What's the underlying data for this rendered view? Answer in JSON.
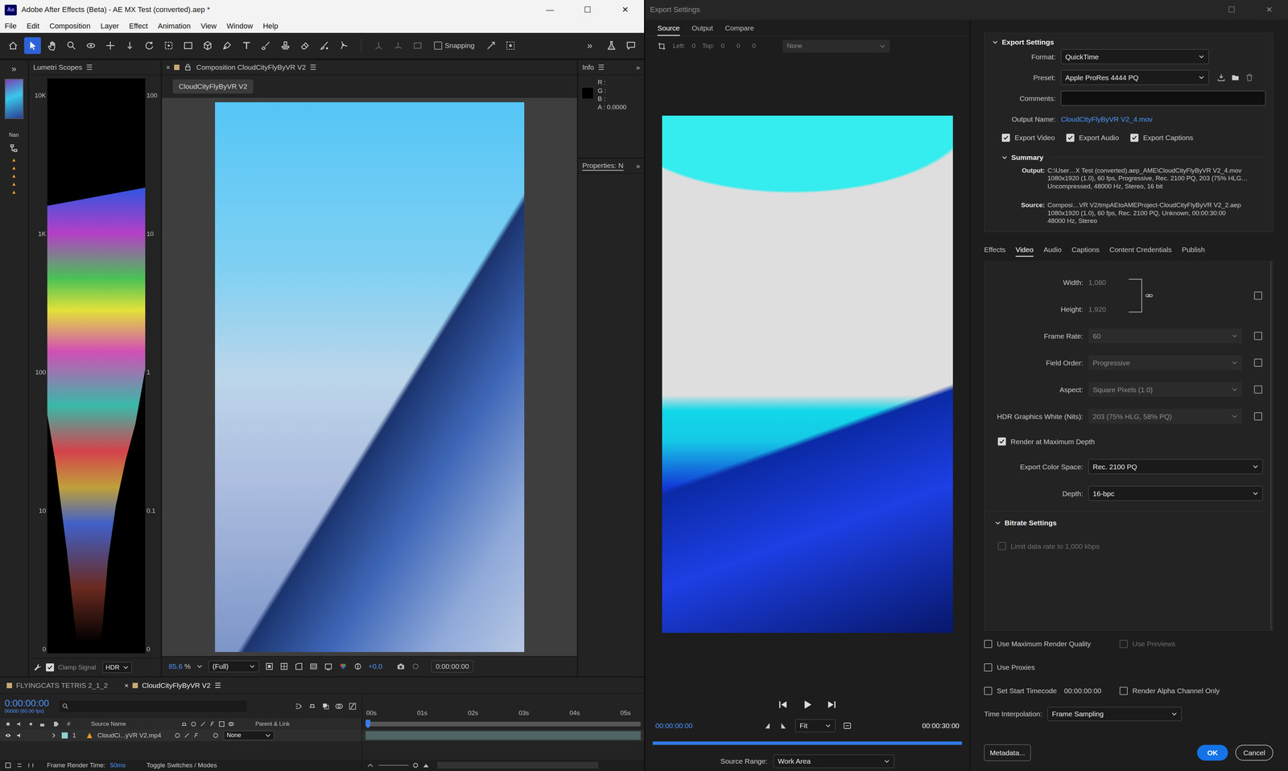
{
  "ae": {
    "title": "Adobe After Effects (Beta) - AE MX Test (converted).aep *",
    "app_badge": "Ae",
    "window_controls": [
      "—",
      "☐",
      "✕"
    ],
    "menu": [
      "File",
      "Edit",
      "Composition",
      "Layer",
      "Effect",
      "Animation",
      "View",
      "Window",
      "Help"
    ],
    "tools": [
      {
        "selected": false
      },
      {
        "selected": true
      },
      {
        "selected": false
      },
      {
        "selected": false
      },
      {
        "selected": false
      },
      {
        "selected": false
      },
      {
        "selected": false
      },
      {
        "selected": false
      },
      {
        "selected": false
      },
      {
        "selected": false
      },
      {
        "selected": false
      },
      {
        "selected": false
      },
      {
        "selected": false
      },
      {
        "selected": false
      },
      {
        "selected": false
      },
      {
        "selected": false
      },
      {
        "selected": false
      },
      {
        "selected": false
      }
    ],
    "snapping": {
      "label": "Snapping",
      "checked": false
    },
    "toolbar_more": "»",
    "project": {
      "more": "»",
      "column": "Nan"
    },
    "scopes": {
      "title": "Lumetri Scopes",
      "menu": "☰",
      "left_ticks": [
        "10K",
        "1K",
        "100",
        "10",
        "0"
      ],
      "right_ticks": [
        "100",
        "10",
        "1",
        "0.1",
        "0"
      ],
      "clamp": {
        "label": "Clamp Signal",
        "checked": true
      },
      "mode": "HDR"
    },
    "comp": {
      "close": "×",
      "title": "Composition CloudCityFlyByVR V2",
      "menu": "☰",
      "breadcrumb": "CloudCityFlyByVR V2",
      "zoom": "85.6",
      "zoom_unit": "%",
      "resolution": "(Full)",
      "exposure": "+0.0",
      "timecode": "0:00:00:00"
    },
    "info": {
      "title": "Info",
      "menu": "☰",
      "more": "»",
      "channels": [
        "R :",
        "G :",
        "B :",
        "A : 0.0000"
      ]
    },
    "properties": {
      "title": "Properties: N",
      "more": "»"
    },
    "timeline": {
      "tabs": [
        {
          "label": "FLYINGCATS TETRIS 2_1_2",
          "selected": false
        },
        {
          "label": "CloudCityFlyByVR V2",
          "selected": true
        }
      ],
      "close": "×",
      "menu": "☰",
      "timecode": "0:00:00:00",
      "frame": "00000 (60.00 fps)",
      "ruler": [
        "00s",
        "01s",
        "02s",
        "03s",
        "04s",
        "05s"
      ],
      "columns": {
        "number": "#",
        "source": "Source Name",
        "parent": "Parent & Link"
      },
      "layers": [
        {
          "number": "1",
          "name": "CloudCi...yVR V2.mp4",
          "parent": "None",
          "visible": true,
          "expanded": false
        }
      ],
      "render_label": "Frame Render Time:",
      "render_time": "50ms",
      "toggle": "Toggle Switches / Modes"
    }
  },
  "export": {
    "title": "Export Settings",
    "window_controls": [
      "☐",
      "✕"
    ],
    "tabs": [
      {
        "label": "Source",
        "selected": true
      },
      {
        "label": "Output",
        "selected": false
      },
      {
        "label": "Compare",
        "selected": false
      }
    ],
    "crop": [
      "Left:",
      "0",
      "Top:",
      "0",
      "0",
      "0"
    ],
    "crop_ratio": "None",
    "current_time": "00:00:00:00",
    "fit": "Fit",
    "duration": "00:00:30:00",
    "range_level": 1,
    "source_range": {
      "label": "Source Range:",
      "value": "Work Area"
    },
    "settings": {
      "title": "Export Settings",
      "expanded": true,
      "format": {
        "label": "Format:",
        "value": "QuickTime"
      },
      "preset": {
        "label": "Preset:",
        "value": "Apple ProRes 4444 PQ"
      },
      "comments": {
        "label": "Comments:"
      },
      "output_name": {
        "label": "Output Name:",
        "value": "CloudCityFlyByVR V2_4.mov"
      },
      "exports": [
        {
          "label": "Export Video",
          "checked": true
        },
        {
          "label": "Export Audio",
          "checked": true
        },
        {
          "label": "Export Captions",
          "checked": true
        }
      ]
    },
    "summary": {
      "title": "Summary",
      "expanded": true,
      "output_label": "Output:",
      "output_lines": [
        "C:\\User…X Test (converted).aep_AME\\CloudCityFlyByVR V2_4.mov",
        "1080x1920 (1.0), 60 fps, Progressive, Rec. 2100 PQ, 203 (75% HLG…",
        "Uncompressed, 48000 Hz, Stereo, 16 bit"
      ],
      "source_label": "Source:",
      "source_lines": [
        "Composi…VR V2/tmpAEtoAMEProject-CloudCityFlyByVR V2_2.aep",
        "1080x1920 (1.0), 60 fps, Rec. 2100 PQ, Unknown, 00:00:30:00",
        "48000 Hz, Stereo"
      ]
    },
    "panel_tabs": [
      {
        "label": "Effects",
        "selected": false
      },
      {
        "label": "Video",
        "selected": true
      },
      {
        "label": "Audio",
        "selected": false
      },
      {
        "label": "Captions",
        "selected": false
      },
      {
        "label": "Content Credentials",
        "selected": false
      },
      {
        "label": "Publish",
        "selected": false
      }
    ],
    "video": {
      "width": {
        "label": "Width:",
        "value": "1,080"
      },
      "height": {
        "label": "Height:",
        "value": "1,920"
      },
      "size_disabled": true,
      "size_match": true,
      "rows": [
        {
          "label": "Frame Rate:",
          "value": "60",
          "disabled": true,
          "match": true
        },
        {
          "label": "Field Order:",
          "value": "Progressive",
          "disabled": true,
          "match": true
        },
        {
          "label": "Aspect:",
          "value": "Square Pixels (1.0)",
          "disabled": true,
          "match": true
        },
        {
          "label": "HDR Graphics White (Nits):",
          "value": "203 (75% HLG, 58% PQ)",
          "disabled": true,
          "match": true
        }
      ],
      "max_depth": {
        "label": "Render at Maximum Depth",
        "checked": true
      },
      "color_space": {
        "label": "Export Color Space:",
        "value": "Rec. 2100 PQ"
      },
      "depth": {
        "label": "Depth:",
        "value": "16-bpc"
      }
    },
    "bitrate": {
      "title": "Bitrate Settings",
      "expanded": true,
      "limit": {
        "label": "Limit data rate to 1,000 kbps",
        "checked": false,
        "disabled": true
      }
    },
    "options": {
      "max_quality": {
        "label": "Use Maximum Render Quality",
        "checked": false
      },
      "previews": {
        "label": "Use Previews",
        "checked": false,
        "disabled": true
      },
      "proxies": {
        "label": "Use Proxies",
        "checked": false
      },
      "start_tc": {
        "label": "Set Start Timecode",
        "value": "00:00:00:00",
        "checked": false,
        "value_disabled": true
      },
      "alpha": {
        "label": "Render Alpha Channel Only",
        "checked": false
      }
    },
    "time_interpolation": {
      "label": "Time Interpolation:",
      "value": "Frame Sampling"
    },
    "buttons": {
      "metadata": "Metadata...",
      "ok": "OK",
      "cancel": "Cancel"
    }
  }
}
